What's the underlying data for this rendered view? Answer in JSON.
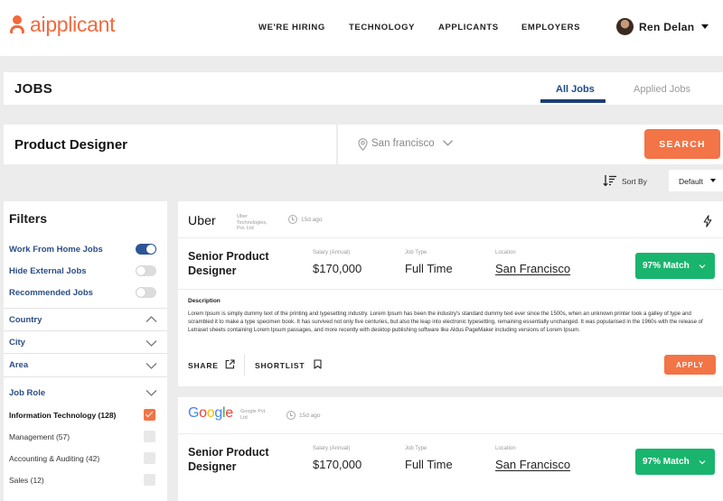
{
  "brand": {
    "prefix": "ai",
    "rest": "pplicant"
  },
  "nav": {
    "links": [
      "WE'RE HIRING",
      "TECHNOLOGY",
      "APPLICANTS",
      "EMPLOYERS"
    ],
    "user": "Ren Delan"
  },
  "jobs_bar": {
    "title": "JOBS",
    "tabs": [
      {
        "label": "All Jobs",
        "active": true
      },
      {
        "label": "Applied Jobs",
        "active": false
      }
    ]
  },
  "search": {
    "query": "Product Designer",
    "location": "San francisco",
    "button": "SEARCH"
  },
  "sort": {
    "label": "Sort By",
    "value": "Default"
  },
  "filters": {
    "title": "Filters",
    "toggles": [
      {
        "label": "Work From Home Jobs",
        "on": true
      },
      {
        "label": "Hide External Jobs",
        "on": false
      },
      {
        "label": "Recommended Jobs",
        "on": false
      }
    ],
    "sections": [
      {
        "label": "Country",
        "expanded": true
      },
      {
        "label": "City",
        "expanded": false
      },
      {
        "label": "Area",
        "expanded": false
      },
      {
        "label": "Job Role",
        "expanded": false
      }
    ],
    "roles": [
      {
        "label": "Information Technology (128)",
        "checked": true
      },
      {
        "label": "Management (57)",
        "checked": false
      },
      {
        "label": "Accounting & Auditing (42)",
        "checked": false
      },
      {
        "label": "Sales (12)",
        "checked": false
      }
    ]
  },
  "jobs": [
    {
      "company_logo": "Uber",
      "company_name": "Uber Technologies, Pvt. Ltd",
      "posted": "15d ago",
      "title": "Senior Product Designer",
      "salary_label": "Salary (Annual)",
      "salary": "$170,000",
      "type_label": "Job Type",
      "type": "Full Time",
      "location_label": "Location",
      "location": "San Francisco",
      "match": "97% Match",
      "description_label": "Description",
      "description": "Lorem Ipsum is simply dummy text of the printing and typesetting industry. Lorem Ipsum has been the industry's standard dummy text ever since the 1500s, when an unknown printer took a galley of type and scrambled it to make a type specimen book. It has survived not only five centuries, but also the leap into electronic typesetting, remaining essentially unchanged. It was popularised in the 1960s with the release of Letraset sheets containing Lorem Ipsum passages, and more recently with desktop publishing software like Aldus PageMaker including versions of Lorem Ipsum.",
      "share": "SHARE",
      "shortlist": "SHORTLIST",
      "apply": "APPLY"
    },
    {
      "company_logo": "Google",
      "company_name": "Google Pvt. Ltd",
      "posted": "15d ago",
      "title": "Senior Product Designer",
      "salary_label": "Salary (Annual)",
      "salary": "$170,000",
      "type_label": "Job Type",
      "type": "Full Time",
      "location_label": "Location",
      "location": "San Francisco",
      "match": "97% Match"
    }
  ],
  "colors": {
    "accent": "#f27447",
    "match": "#19b46d",
    "navy": "#1e3f73",
    "filter_text": "#2a4e85"
  },
  "icons": [
    "location-pin-icon",
    "chevron-down-icon",
    "chevron-up-icon",
    "sort-icon",
    "clock-icon",
    "bolt-icon",
    "share-icon",
    "bookmark-icon",
    "checkmark-icon"
  ]
}
